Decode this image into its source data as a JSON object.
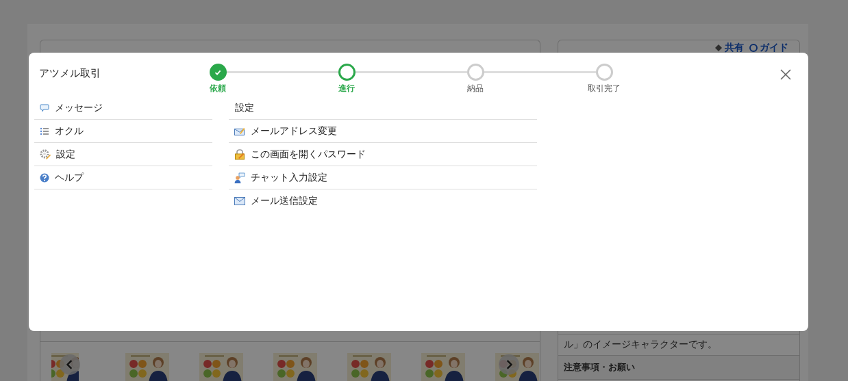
{
  "background": {
    "links": [
      {
        "label": "共有"
      },
      {
        "label": "ガイド"
      }
    ],
    "notes": [
      {
        "kind": "text",
        "text": "ル」のイメージキャラクターです。"
      },
      {
        "kind": "heading",
        "text": "注意事項・お願い"
      }
    ]
  },
  "modal": {
    "title": "アツメル取引",
    "steps": [
      {
        "label": "依頼",
        "done": true,
        "active": false
      },
      {
        "label": "進行",
        "done": false,
        "active": true
      },
      {
        "label": "納品",
        "done": false,
        "active": false
      },
      {
        "label": "取引完了",
        "done": false,
        "active": false
      }
    ],
    "menu": [
      {
        "label": "メッセージ"
      },
      {
        "label": "オクル"
      },
      {
        "label": "設定"
      },
      {
        "label": "ヘルプ"
      }
    ],
    "settings": {
      "heading": "設定",
      "items": [
        {
          "label": "メールアドレス変更"
        },
        {
          "label": "この画面を開くパスワード"
        },
        {
          "label": "チャット入力設定"
        },
        {
          "label": "メール送信設定"
        }
      ]
    }
  }
}
